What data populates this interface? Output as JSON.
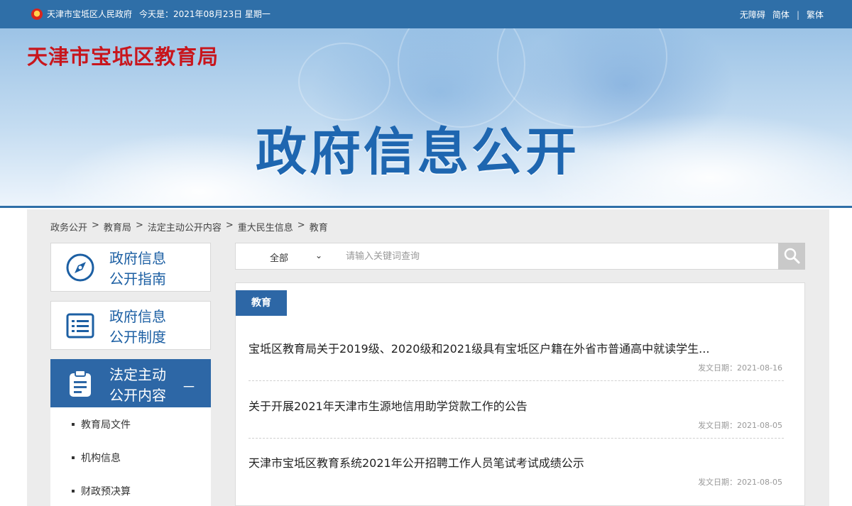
{
  "topbar": {
    "site": "天津市宝坻区人民政府",
    "today": "今天是：2021年08月23日 星期一",
    "links": [
      "无障碍",
      "简体",
      "繁体"
    ]
  },
  "banner": {
    "site_title": "天津市宝坻区教育局",
    "headline": "政府信息公开"
  },
  "breadcrumb": [
    "政务公开",
    "教育局",
    "法定主动公开内容",
    "重大民生信息",
    "教育"
  ],
  "sidebar": {
    "items": [
      {
        "line1": "政府信息",
        "line2": "公开指南",
        "icon": "compass-icon"
      },
      {
        "line1": "政府信息",
        "line2": "公开制度",
        "icon": "list-icon"
      },
      {
        "line1": "法定主动",
        "line2": "公开内容",
        "icon": "clipboard-icon",
        "toggle": "－"
      }
    ],
    "submenu": [
      "教育局文件",
      "机构信息",
      "财政预决算"
    ]
  },
  "search": {
    "scope": "全部",
    "placeholder": "请输入关键词查询",
    "value": ""
  },
  "panel": {
    "tab": "教育",
    "news": [
      {
        "title": "宝坻区教育局关于2019级、2020级和2021级具有宝坻区户籍在外省市普通高中就读学生...",
        "date": "发文日期：2021-08-16"
      },
      {
        "title": "关于开展2021年天津市生源地信用助学贷款工作的公告",
        "date": "发文日期：2021-08-05"
      },
      {
        "title": "天津市宝坻区教育系统2021年公开招聘工作人员笔试考试成绩公示",
        "date": "发文日期：2021-08-05"
      }
    ]
  },
  "colors": {
    "primary": "#2d67a6",
    "site_title": "#c8161d",
    "topbar": "#2f6fa8"
  }
}
